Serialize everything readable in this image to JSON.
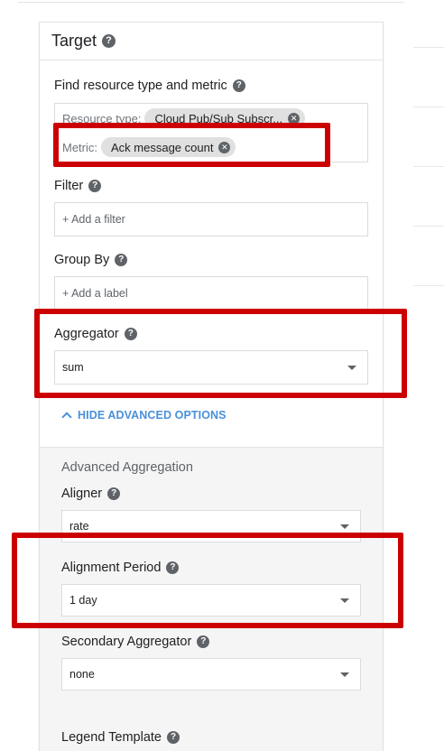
{
  "panel": {
    "title": "Target"
  },
  "find": {
    "label": "Find resource type and metric",
    "resource_prefix": "Resource type:",
    "resource_chip": "Cloud Pub/Sub Subscr...",
    "metric_prefix": "Metric:",
    "metric_chip": "Ack message count"
  },
  "filter": {
    "label": "Filter",
    "placeholder": "+ Add a filter"
  },
  "group_by": {
    "label": "Group By",
    "placeholder": "+ Add a label"
  },
  "aggregator": {
    "label": "Aggregator",
    "value": "sum"
  },
  "advanced_toggle": "HIDE ADVANCED OPTIONS",
  "advanced": {
    "title": "Advanced Aggregation",
    "aligner": {
      "label": "Aligner",
      "value": "rate"
    },
    "alignment_period": {
      "label": "Alignment Period",
      "value": "1 day"
    },
    "secondary_aggregator": {
      "label": "Secondary Aggregator",
      "value": "none"
    },
    "legend_template": {
      "label": "Legend Template"
    }
  },
  "colors": {
    "highlight": "#cc0000",
    "link": "#4a90d9"
  }
}
